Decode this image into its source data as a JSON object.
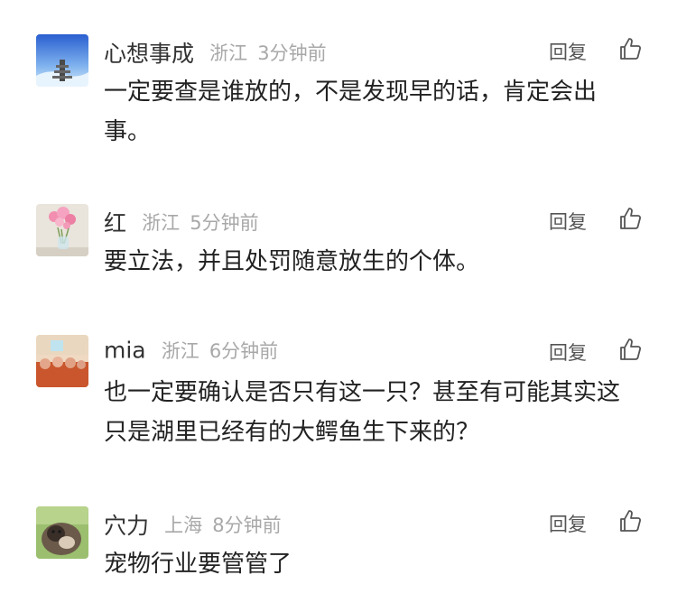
{
  "comments": [
    {
      "username": "心想事成",
      "location": "浙江",
      "time": "3分钟前",
      "reply_label": "回复",
      "text": "一定要查是谁放的，不是发现早的话，肯定会出事。",
      "avatar": "sky-stairs-avatar"
    },
    {
      "username": "红",
      "location": "浙江",
      "time": "5分钟前",
      "reply_label": "回复",
      "text": "要立法，并且处罚随意放生的个体。",
      "avatar": "pink-flowers-vase-avatar"
    },
    {
      "username": "mia",
      "location": "浙江",
      "time": "6分钟前",
      "reply_label": "回复",
      "text": "也一定要确认是否只有这一只？甚至有可能其实这只是湖里已经有的大鳄鱼生下来的？",
      "avatar": "orange-room-avatar"
    },
    {
      "username": "穴力",
      "location": "上海",
      "time": "8分钟前",
      "reply_label": "回复",
      "text": "宠物行业要管管了",
      "avatar": "cat-photo-avatar"
    }
  ],
  "colors": {
    "text": "#222222",
    "username": "#333333",
    "meta": "#a8a8a8",
    "reply": "#555555"
  }
}
